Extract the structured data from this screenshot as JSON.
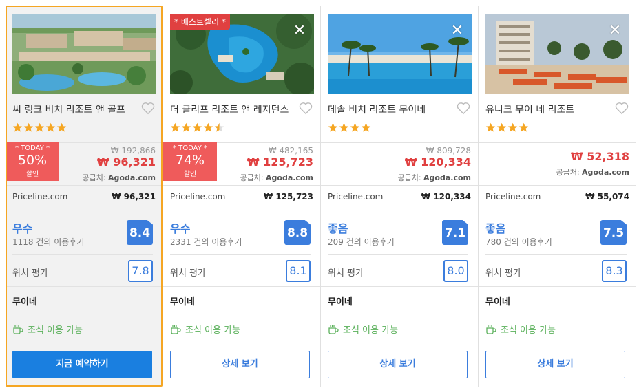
{
  "cards": [
    {
      "name": "씨 링크 비치 리조트 앤 골프",
      "stars": 5,
      "badge": null,
      "deal": {
        "today": "* TODAY *",
        "pct": "50%",
        "label": "할인"
      },
      "old_price": "₩ 192,866",
      "new_price": "₩ 96,321",
      "supplier_label": "공급처:",
      "supplier": "Agoda.com",
      "vendor": "Priceline.com",
      "vendor_price": "₩ 96,321",
      "rating_word": "우수",
      "reviews": "1118 건의 이용후기",
      "score": "8.4",
      "location_label": "위치 평가",
      "location_score": "7.8",
      "area": "무이네",
      "breakfast": "조식 이용 가능",
      "cta": "지금 예약하기"
    },
    {
      "name": "더 클리프 리조트 앤 레지던스",
      "stars": 4.5,
      "badge": "* 베스트셀러 *",
      "deal": {
        "today": "* TODAY *",
        "pct": "74%",
        "label": "할인"
      },
      "old_price": "₩ 482,165",
      "new_price": "₩ 125,723",
      "supplier_label": "공급처:",
      "supplier": "Agoda.com",
      "vendor": "Priceline.com",
      "vendor_price": "₩ 125,723",
      "rating_word": "우수",
      "reviews": "2331 건의 이용후기",
      "score": "8.8",
      "location_label": "위치 평가",
      "location_score": "8.1",
      "area": "무이네",
      "breakfast": "조식 이용 가능",
      "cta": "상세 보기"
    },
    {
      "name": "데솔 비치 리조트 무이네",
      "stars": 4,
      "badge": null,
      "deal": null,
      "old_price": "₩ 809,728",
      "new_price": "₩ 120,334",
      "supplier_label": "공급처:",
      "supplier": "Agoda.com",
      "vendor": "Priceline.com",
      "vendor_price": "₩ 120,334",
      "rating_word": "좋음",
      "reviews": "209 건의 이용후기",
      "score": "7.1",
      "location_label": "위치 평가",
      "location_score": "8.0",
      "area": "무이네",
      "breakfast": "조식 이용 가능",
      "cta": "상세 보기"
    },
    {
      "name": "유니크 무이 네 리조트",
      "stars": 4,
      "badge": null,
      "deal": null,
      "old_price": "",
      "new_price": "₩ 52,318",
      "supplier_label": "공급처:",
      "supplier": "Agoda.com",
      "vendor": "Priceline.com",
      "vendor_price": "₩ 55,074",
      "rating_word": "좋음",
      "reviews": "780 건의 이용후기",
      "score": "7.5",
      "location_label": "위치 평가",
      "location_score": "8.3",
      "area": "무이네",
      "breakfast": "조식 이용 가능",
      "cta": "상세 보기"
    }
  ],
  "icons": {
    "close": "close-icon",
    "heart": "heart-outline-icon",
    "star": "star-icon",
    "coffee": "coffee-cup-icon"
  },
  "colors": {
    "accent_blue": "#3b7ddd",
    "cta_blue": "#1a7fe0",
    "price_red": "#e04040",
    "deal_red": "#ef5b5b",
    "star_orange": "#f5a623",
    "selected_border": "#f5a623",
    "breakfast_green": "#5ab05a"
  }
}
